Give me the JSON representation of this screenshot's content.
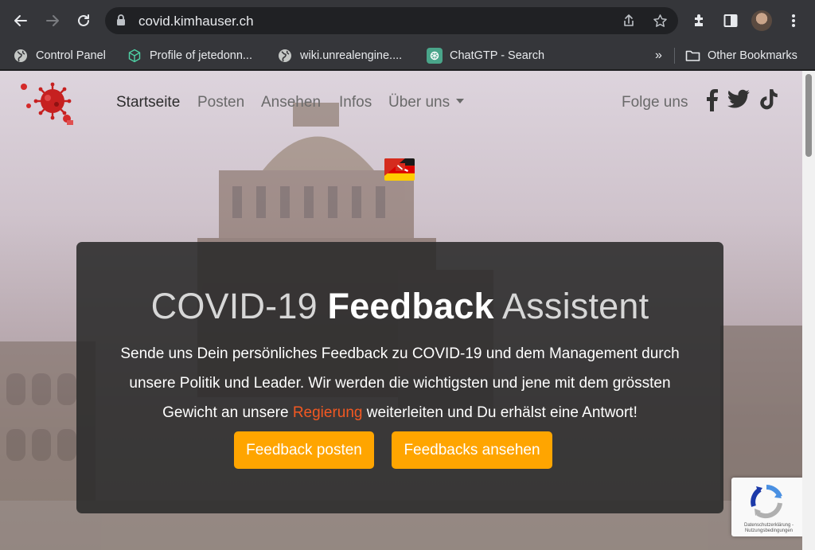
{
  "browser": {
    "url": "covid.kimhauser.ch",
    "bookmarks": [
      {
        "label": "Control Panel",
        "icon": "globe-icon"
      },
      {
        "label": "Profile of jetedonn...",
        "icon": "cube-icon"
      },
      {
        "label": "wiki.unrealengine....",
        "icon": "globe-icon"
      },
      {
        "label": "ChatGTP - Search",
        "icon": "openai-icon"
      }
    ],
    "overflow_label": "»",
    "other_bookmarks": "Other Bookmarks"
  },
  "page": {
    "nav": {
      "items": [
        "Startseite",
        "Posten",
        "Ansehen",
        "Infos",
        "Über uns"
      ],
      "active": "Startseite",
      "follow_label": "Folge uns",
      "social": [
        "facebook-icon",
        "twitter-icon",
        "tiktok-icon"
      ]
    },
    "hero": {
      "title_pre": "COVID-19",
      "title_bold": "Feedback",
      "title_post": "Assistent",
      "text_before": "Sende uns Dein persönliches Feedback zu COVID-19 und dem Management durch unsere Politik und Leader. Wir werden die wichtigsten und jene mit dem grössten Gewicht an unsere",
      "text_highlight": "Regierung",
      "text_after": "weiterleiten und Du erhälst eine Antwort!",
      "btn_post": "Feedback posten",
      "btn_view": "Feedbacks ansehen"
    },
    "recaptcha": {
      "footer": "Datenschutzerklärung - Nutzungsbedingungen"
    }
  },
  "colors": {
    "accent_button": "#ffa500",
    "highlight": "#f25822",
    "hero_bg": "#2a2a2a"
  }
}
